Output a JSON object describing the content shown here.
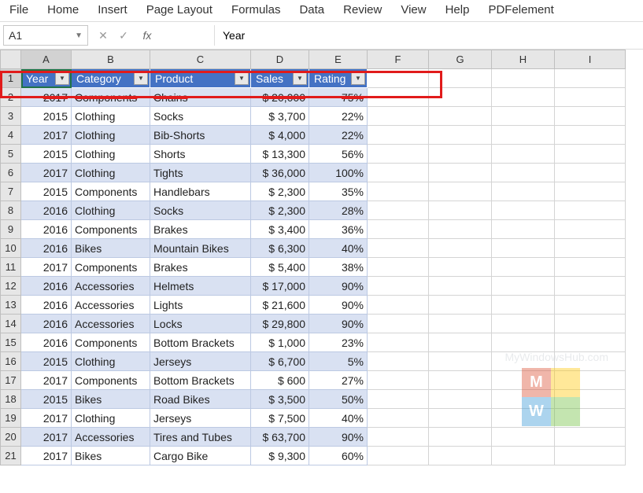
{
  "menubar": [
    "File",
    "Home",
    "Insert",
    "Page Layout",
    "Formulas",
    "Data",
    "Review",
    "View",
    "Help",
    "PDFelement"
  ],
  "namebox": {
    "value": "A1"
  },
  "formula": {
    "label": "fx",
    "value": "Year"
  },
  "col_headers": [
    "A",
    "B",
    "C",
    "D",
    "E",
    "F",
    "G",
    "H",
    "I"
  ],
  "table_headers": [
    "Year",
    "Category",
    "Product",
    "Sales",
    "Rating"
  ],
  "rows": [
    {
      "n": 2,
      "band": true,
      "year": "2017",
      "cat": "Components",
      "prod": "Chains",
      "sales": "$ 20,000",
      "rating": "75%",
      "strike": true
    },
    {
      "n": 3,
      "band": false,
      "year": "2015",
      "cat": "Clothing",
      "prod": "Socks",
      "sales": "$   3,700",
      "rating": "22%"
    },
    {
      "n": 4,
      "band": true,
      "year": "2017",
      "cat": "Clothing",
      "prod": "Bib-Shorts",
      "sales": "$   4,000",
      "rating": "22%"
    },
    {
      "n": 5,
      "band": false,
      "year": "2015",
      "cat": "Clothing",
      "prod": "Shorts",
      "sales": "$ 13,300",
      "rating": "56%"
    },
    {
      "n": 6,
      "band": true,
      "year": "2017",
      "cat": "Clothing",
      "prod": "Tights",
      "sales": "$ 36,000",
      "rating": "100%"
    },
    {
      "n": 7,
      "band": false,
      "year": "2015",
      "cat": "Components",
      "prod": "Handlebars",
      "sales": "$   2,300",
      "rating": "35%"
    },
    {
      "n": 8,
      "band": true,
      "year": "2016",
      "cat": "Clothing",
      "prod": "Socks",
      "sales": "$   2,300",
      "rating": "28%"
    },
    {
      "n": 9,
      "band": false,
      "year": "2016",
      "cat": "Components",
      "prod": "Brakes",
      "sales": "$   3,400",
      "rating": "36%"
    },
    {
      "n": 10,
      "band": true,
      "year": "2016",
      "cat": "Bikes",
      "prod": "Mountain Bikes",
      "sales": "$   6,300",
      "rating": "40%"
    },
    {
      "n": 11,
      "band": false,
      "year": "2017",
      "cat": "Components",
      "prod": "Brakes",
      "sales": "$   5,400",
      "rating": "38%"
    },
    {
      "n": 12,
      "band": true,
      "year": "2016",
      "cat": "Accessories",
      "prod": "Helmets",
      "sales": "$ 17,000",
      "rating": "90%"
    },
    {
      "n": 13,
      "band": false,
      "year": "2016",
      "cat": "Accessories",
      "prod": "Lights",
      "sales": "$ 21,600",
      "rating": "90%"
    },
    {
      "n": 14,
      "band": true,
      "year": "2016",
      "cat": "Accessories",
      "prod": "Locks",
      "sales": "$ 29,800",
      "rating": "90%"
    },
    {
      "n": 15,
      "band": false,
      "year": "2016",
      "cat": "Components",
      "prod": "Bottom Brackets",
      "sales": "$   1,000",
      "rating": "23%"
    },
    {
      "n": 16,
      "band": true,
      "year": "2015",
      "cat": "Clothing",
      "prod": "Jerseys",
      "sales": "$   6,700",
      "rating": "5%"
    },
    {
      "n": 17,
      "band": false,
      "year": "2017",
      "cat": "Components",
      "prod": "Bottom Brackets",
      "sales": "$      600",
      "rating": "27%"
    },
    {
      "n": 18,
      "band": true,
      "year": "2015",
      "cat": "Bikes",
      "prod": "Road Bikes",
      "sales": "$   3,500",
      "rating": "50%"
    },
    {
      "n": 19,
      "band": false,
      "year": "2017",
      "cat": "Clothing",
      "prod": "Jerseys",
      "sales": "$   7,500",
      "rating": "40%"
    },
    {
      "n": 20,
      "band": true,
      "year": "2017",
      "cat": "Accessories",
      "prod": "Tires and Tubes",
      "sales": "$ 63,700",
      "rating": "90%"
    },
    {
      "n": 21,
      "band": false,
      "year": "2017",
      "cat": "Bikes",
      "prod": "Cargo Bike",
      "sales": "$   9,300",
      "rating": "60%"
    }
  ],
  "watermark": {
    "text": "MyWindowsHub.com",
    "letters": [
      "M",
      "",
      "W",
      ""
    ]
  }
}
